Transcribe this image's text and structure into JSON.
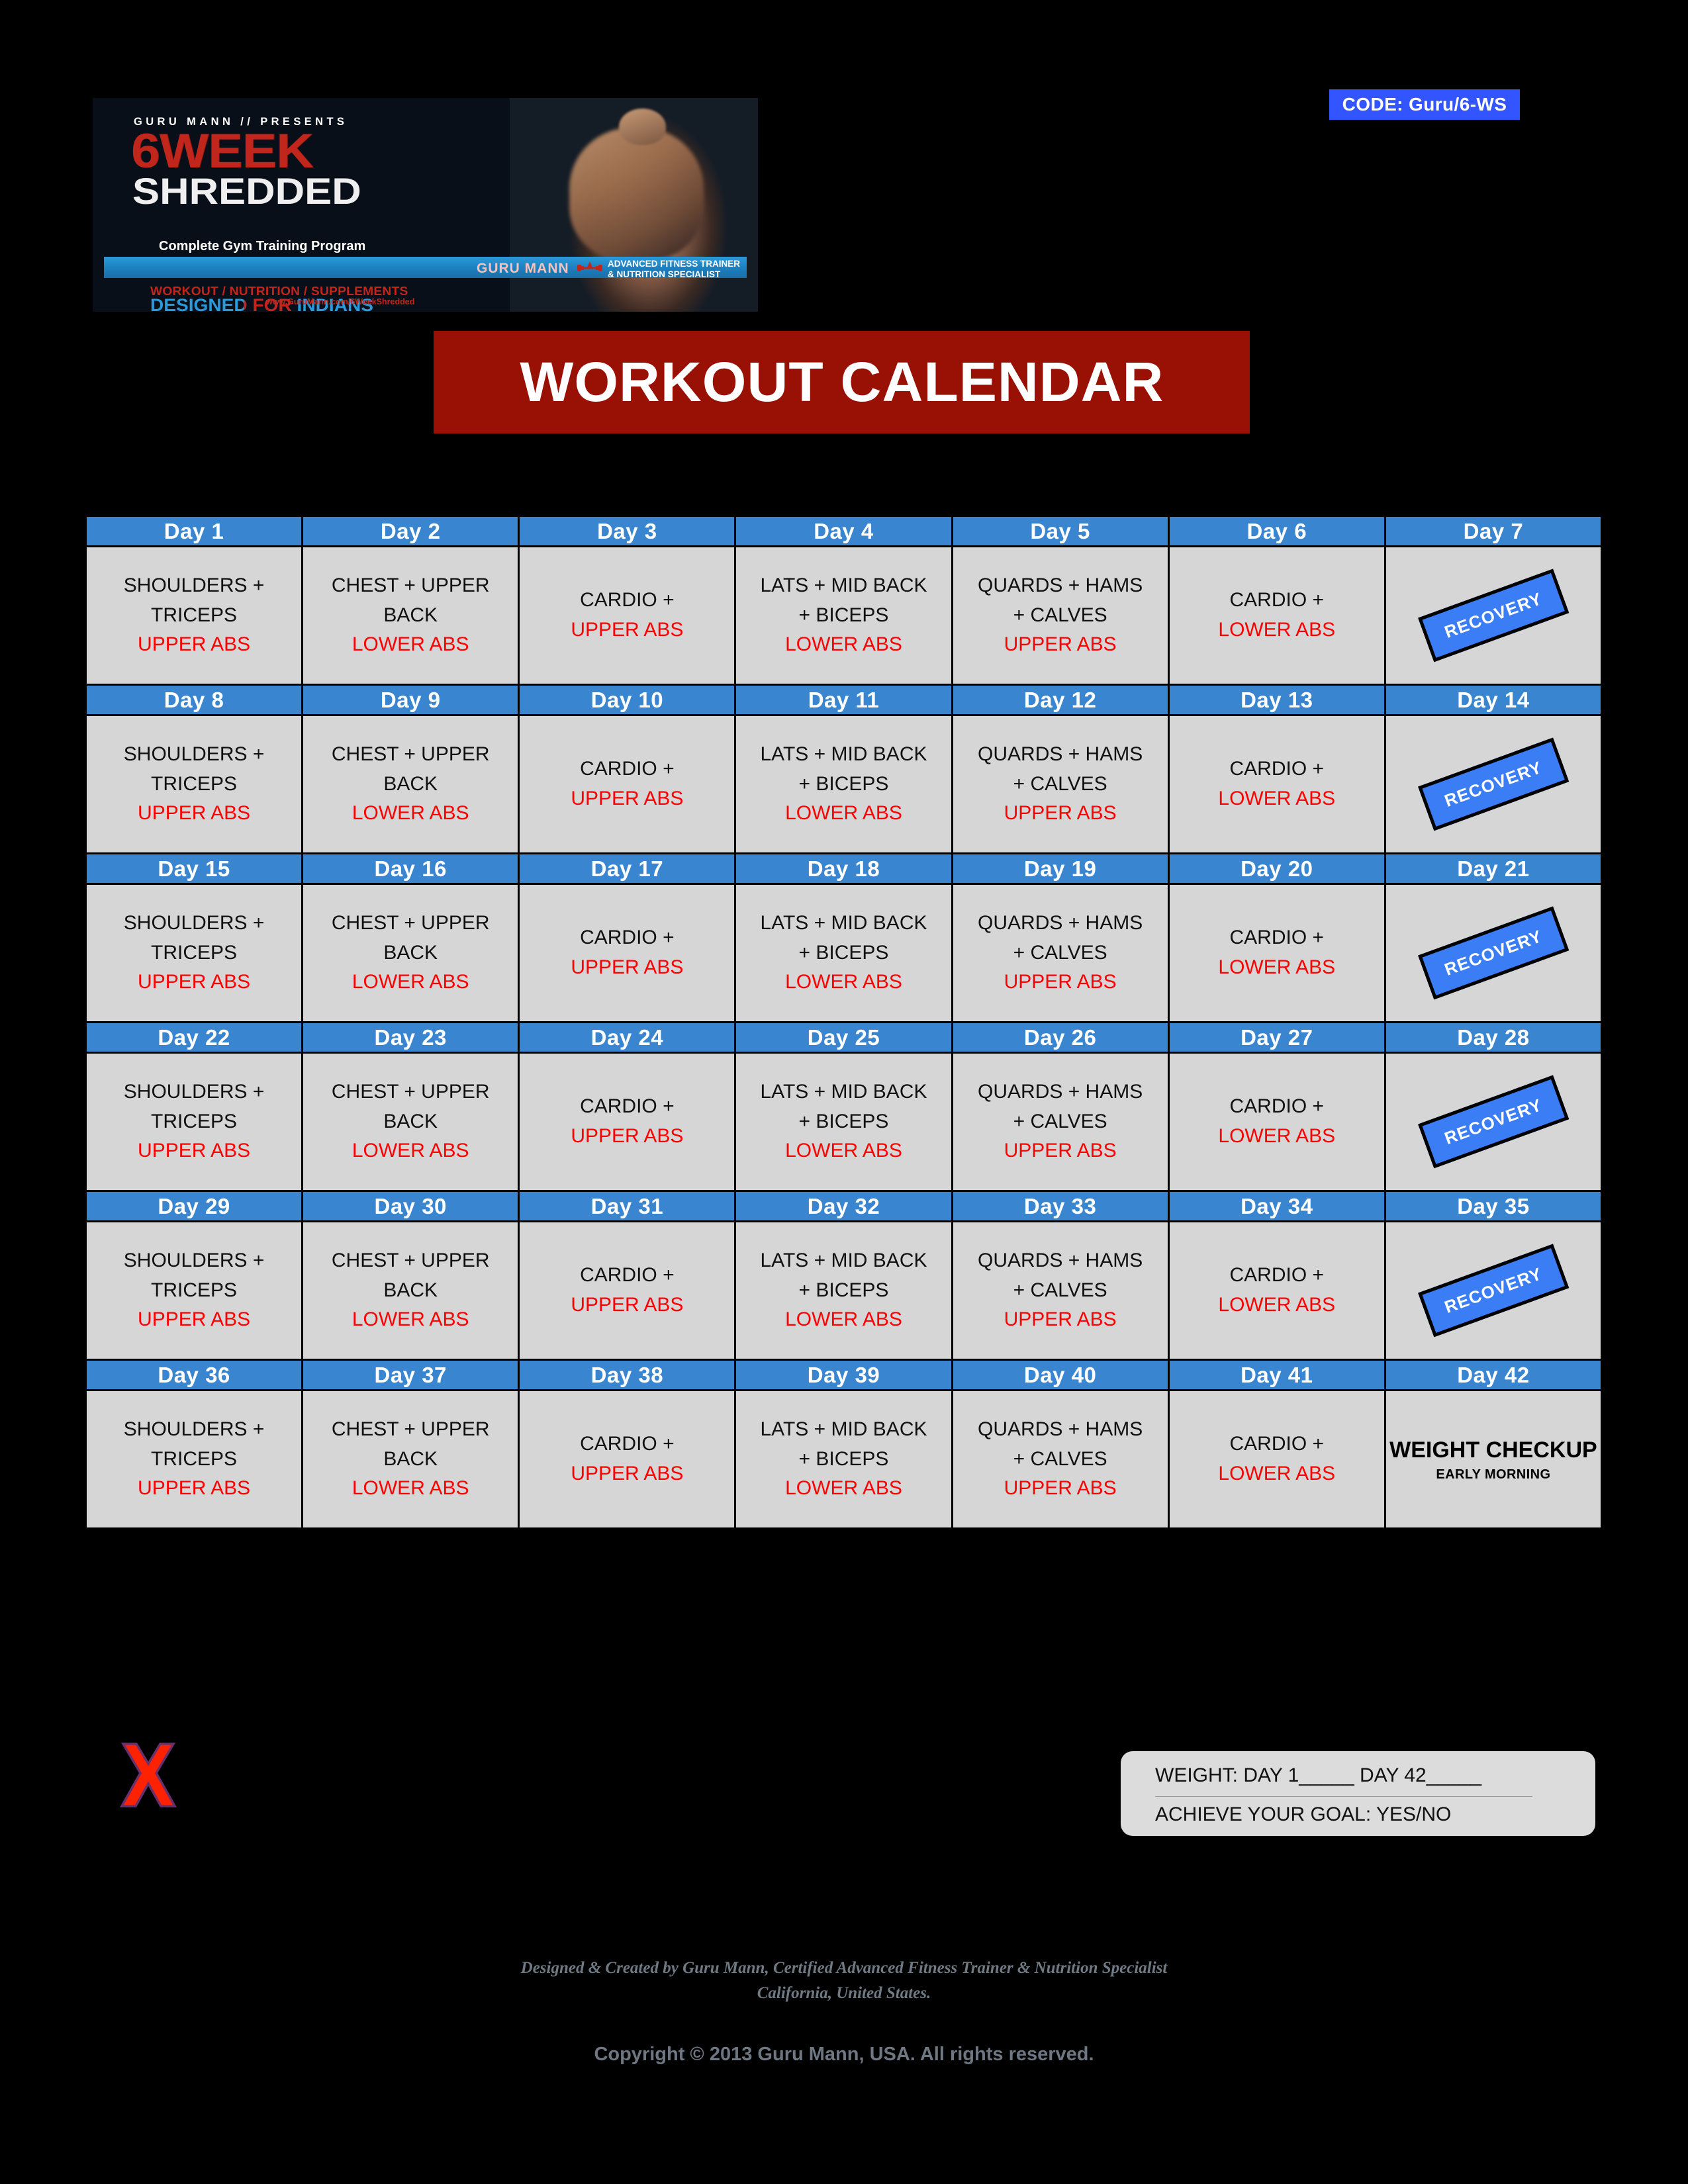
{
  "code_badge": {
    "label": "CODE: Guru/6-WS"
  },
  "banner": {
    "presents": "GURU MANN  //  PRESENTS",
    "program_number_word": "6WEEK",
    "program_name": "SHREDDED",
    "tagline": "Complete Gym Training Program",
    "trainer_name": "GURU MANN",
    "certification_line_1": "ADVANCED FITNESS TRAINER",
    "certification_line_2": "& NUTRITION SPECIALIST",
    "categories": "WORKOUT / NUTRITION / SUPPLEMENTS",
    "audience": "DESIGNED FOR INDIANS",
    "url": "www.GuruMann.com/6WeekShredded"
  },
  "title": {
    "text": "WORKOUT CALENDAR"
  },
  "calendar": {
    "weeks": [
      {
        "days": [
          {
            "label": "Day 1",
            "lines": [
              "SHOULDERS +",
              "TRICEPS"
            ],
            "accent": "UPPER ABS",
            "type": "workout"
          },
          {
            "label": "Day 2",
            "lines": [
              "CHEST + UPPER",
              "BACK"
            ],
            "accent": "LOWER ABS",
            "type": "workout"
          },
          {
            "label": "Day 3",
            "lines": [
              "CARDIO +"
            ],
            "accent": "UPPER ABS",
            "type": "workout"
          },
          {
            "label": "Day 4",
            "lines": [
              "LATS + MID BACK",
              "+ BICEPS"
            ],
            "accent": "LOWER ABS",
            "type": "workout"
          },
          {
            "label": "Day 5",
            "lines": [
              "QUARDS + HAMS",
              "+ CALVES"
            ],
            "accent": "UPPER ABS",
            "type": "workout"
          },
          {
            "label": "Day 6",
            "lines": [
              "CARDIO +"
            ],
            "accent": "LOWER ABS",
            "type": "workout"
          },
          {
            "label": "Day 7",
            "lines": [],
            "accent": "",
            "type": "recovery",
            "stamp": "RECOVERY"
          }
        ]
      },
      {
        "days": [
          {
            "label": "Day 8",
            "lines": [
              "SHOULDERS +",
              "TRICEPS"
            ],
            "accent": "UPPER ABS",
            "type": "workout"
          },
          {
            "label": "Day 9",
            "lines": [
              "CHEST + UPPER",
              "BACK"
            ],
            "accent": "LOWER ABS",
            "type": "workout"
          },
          {
            "label": "Day 10",
            "lines": [
              "CARDIO +"
            ],
            "accent": "UPPER ABS",
            "type": "workout"
          },
          {
            "label": "Day 11",
            "lines": [
              "LATS + MID BACK",
              "+ BICEPS"
            ],
            "accent": "LOWER ABS",
            "type": "workout"
          },
          {
            "label": "Day 12",
            "lines": [
              "QUARDS + HAMS",
              "+ CALVES"
            ],
            "accent": "UPPER ABS",
            "type": "workout"
          },
          {
            "label": "Day 13",
            "lines": [
              "CARDIO +"
            ],
            "accent": "LOWER ABS",
            "type": "workout"
          },
          {
            "label": "Day 14",
            "lines": [],
            "accent": "",
            "type": "recovery",
            "stamp": "RECOVERY"
          }
        ]
      },
      {
        "days": [
          {
            "label": "Day 15",
            "lines": [
              "SHOULDERS +",
              "TRICEPS"
            ],
            "accent": "UPPER ABS",
            "type": "workout"
          },
          {
            "label": "Day 16",
            "lines": [
              "CHEST + UPPER",
              "BACK"
            ],
            "accent": "LOWER ABS",
            "type": "workout"
          },
          {
            "label": "Day 17",
            "lines": [
              "CARDIO +"
            ],
            "accent": "UPPER ABS",
            "type": "workout"
          },
          {
            "label": "Day 18",
            "lines": [
              "LATS + MID BACK",
              "+ BICEPS"
            ],
            "accent": "LOWER ABS",
            "type": "workout"
          },
          {
            "label": "Day 19",
            "lines": [
              "QUARDS + HAMS",
              "+ CALVES"
            ],
            "accent": "UPPER ABS",
            "type": "workout"
          },
          {
            "label": "Day 20",
            "lines": [
              "CARDIO +"
            ],
            "accent": "LOWER ABS",
            "type": "workout"
          },
          {
            "label": "Day 21",
            "lines": [],
            "accent": "",
            "type": "recovery",
            "stamp": "RECOVERY"
          }
        ]
      },
      {
        "days": [
          {
            "label": "Day 22",
            "lines": [
              "SHOULDERS +",
              "TRICEPS"
            ],
            "accent": "UPPER ABS",
            "type": "workout"
          },
          {
            "label": "Day 23",
            "lines": [
              "CHEST + UPPER",
              "BACK"
            ],
            "accent": "LOWER ABS",
            "type": "workout"
          },
          {
            "label": "Day 24",
            "lines": [
              "CARDIO +"
            ],
            "accent": "UPPER ABS",
            "type": "workout"
          },
          {
            "label": "Day 25",
            "lines": [
              "LATS + MID BACK",
              "+ BICEPS"
            ],
            "accent": "LOWER ABS",
            "type": "workout"
          },
          {
            "label": "Day 26",
            "lines": [
              "QUARDS + HAMS",
              "+ CALVES"
            ],
            "accent": "UPPER ABS",
            "type": "workout"
          },
          {
            "label": "Day 27",
            "lines": [
              "CARDIO +"
            ],
            "accent": "LOWER ABS",
            "type": "workout"
          },
          {
            "label": "Day 28",
            "lines": [],
            "accent": "",
            "type": "recovery",
            "stamp": "RECOVERY"
          }
        ]
      },
      {
        "days": [
          {
            "label": "Day 29",
            "lines": [
              "SHOULDERS +",
              "TRICEPS"
            ],
            "accent": "UPPER ABS",
            "type": "workout"
          },
          {
            "label": "Day 30",
            "lines": [
              "CHEST + UPPER",
              "BACK"
            ],
            "accent": "LOWER ABS",
            "type": "workout"
          },
          {
            "label": "Day 31",
            "lines": [
              "CARDIO +"
            ],
            "accent": "UPPER ABS",
            "type": "workout"
          },
          {
            "label": "Day 32",
            "lines": [
              "LATS + MID BACK",
              "+ BICEPS"
            ],
            "accent": "LOWER ABS",
            "type": "workout"
          },
          {
            "label": "Day 33",
            "lines": [
              "QUARDS + HAMS",
              "+ CALVES"
            ],
            "accent": "UPPER ABS",
            "type": "workout"
          },
          {
            "label": "Day 34",
            "lines": [
              "CARDIO +"
            ],
            "accent": "LOWER ABS",
            "type": "workout"
          },
          {
            "label": "Day 35",
            "lines": [],
            "accent": "",
            "type": "recovery",
            "stamp": "RECOVERY"
          }
        ]
      },
      {
        "days": [
          {
            "label": "Day 36",
            "lines": [
              "SHOULDERS +",
              "TRICEPS"
            ],
            "accent": "UPPER ABS",
            "type": "workout"
          },
          {
            "label": "Day 37",
            "lines": [
              "CHEST + UPPER",
              "BACK"
            ],
            "accent": "LOWER ABS",
            "type": "workout"
          },
          {
            "label": "Day 38",
            "lines": [
              "CARDIO +"
            ],
            "accent": "UPPER ABS",
            "type": "workout"
          },
          {
            "label": "Day 39",
            "lines": [
              "LATS + MID BACK",
              "+ BICEPS"
            ],
            "accent": "LOWER ABS",
            "type": "workout"
          },
          {
            "label": "Day 40",
            "lines": [
              "QUARDS + HAMS",
              "+ CALVES"
            ],
            "accent": "UPPER ABS",
            "type": "workout"
          },
          {
            "label": "Day 41",
            "lines": [
              "CARDIO +"
            ],
            "accent": "LOWER ABS",
            "type": "workout"
          },
          {
            "label": "Day 42",
            "lines": [],
            "accent": "",
            "type": "checkup",
            "checkup_title": "WEIGHT CHECKUP",
            "checkup_note": "EARLY MORNING"
          }
        ]
      }
    ]
  },
  "weight_box": {
    "line_1": "WEIGHT:  DAY 1_____     DAY 42_____",
    "line_2": "ACHIEVE YOUR GOAL:  YES/NO"
  },
  "footer": {
    "credit_line_1": "Designed & Created by Guru Mann, Certified Advanced Fitness Trainer & Nutrition Specialist",
    "credit_line_2": "California, United States.",
    "copyright": "Copyright © 2013 Guru Mann, USA. All rights reserved."
  },
  "colors": {
    "page_background": "#000000",
    "day_header_blue": "#3a85d0",
    "day_cell_gray": "#d6d6d6",
    "accent_red": "#ff0000",
    "title_bar_red": "#991005",
    "code_badge_blue": "#3355ff",
    "recovery_blue": "#3b7df5",
    "footer_gray": "#707a85",
    "x_mark_red": "#ff2200"
  }
}
